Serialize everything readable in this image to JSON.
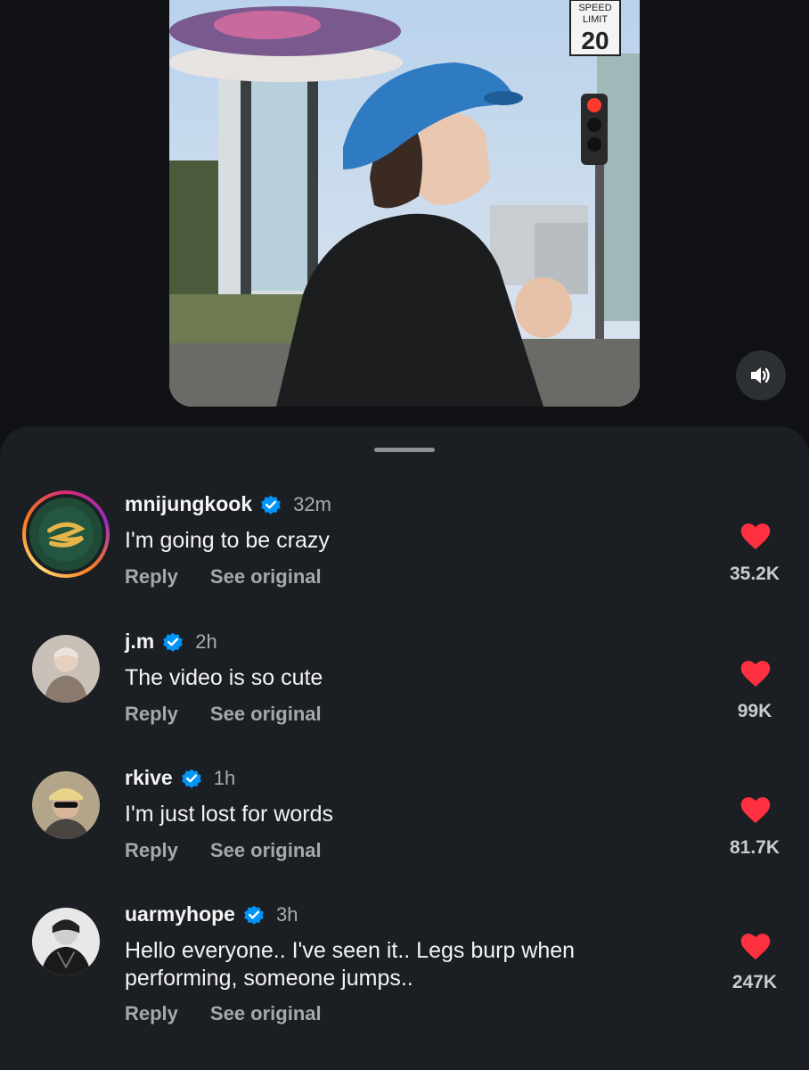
{
  "video": {
    "sign_line1": "SPEED",
    "sign_line2": "LIMIT",
    "sign_number": "20"
  },
  "sound_icon": "speaker-icon",
  "colors": {
    "sheet_bg": "#1b1e22",
    "heart": "#ff3040",
    "verified": "#0095f6",
    "secondary_text": "#a8abb0"
  },
  "comments": [
    {
      "username": "mnijungkook",
      "time": "32m",
      "text": "I'm going to be crazy",
      "reply": "Reply",
      "see_original": "See original",
      "likes": "35.2K"
    },
    {
      "username": "j.m",
      "time": "2h",
      "text": "The video is so cute",
      "reply": "Reply",
      "see_original": "See original",
      "likes": "99K"
    },
    {
      "username": "rkive",
      "time": "1h",
      "text": "I'm just lost for words",
      "reply": "Reply",
      "see_original": "See original",
      "likes": "81.7K"
    },
    {
      "username": "uarmyhope",
      "time": "3h",
      "text": "Hello everyone.. I've seen it.. Legs burp when performing, someone jumps..",
      "reply": "Reply",
      "see_original": "See original",
      "likes": "247K"
    }
  ]
}
